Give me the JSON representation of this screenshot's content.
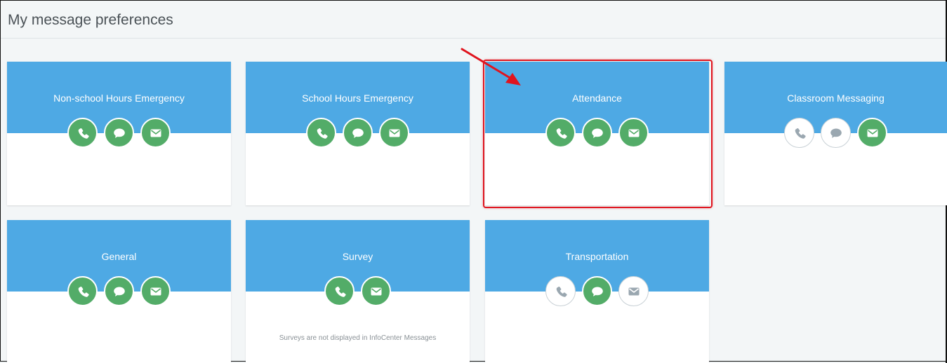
{
  "page": {
    "title": "My message preferences"
  },
  "colors": {
    "band": "#4ea9e4",
    "enabled": "#53ac68",
    "disabled_icon": "#9aa7b0",
    "highlight": "#e0141e"
  },
  "cards": [
    {
      "name": "Non-school Hours Emergency",
      "channels": {
        "phone": true,
        "sms": true,
        "email": true
      }
    },
    {
      "name": "School Hours Emergency",
      "channels": {
        "phone": true,
        "sms": true,
        "email": true
      }
    },
    {
      "name": "Attendance",
      "channels": {
        "phone": true,
        "sms": true,
        "email": true
      },
      "highlighted": true
    },
    {
      "name": "Classroom Messaging",
      "channels": {
        "phone": false,
        "sms": false,
        "email": true
      }
    },
    {
      "name": "General",
      "channels": {
        "phone": true,
        "sms": true,
        "email": true
      }
    },
    {
      "name": "Survey",
      "channels": {
        "phone": true,
        "email": true
      },
      "note": "Surveys are not displayed in InfoCenter Messages"
    },
    {
      "name": "Transportation",
      "channels": {
        "phone": false,
        "sms": true,
        "email": false
      }
    }
  ],
  "icons": {
    "phone": "phone-icon",
    "sms": "chat-bubble-icon",
    "email": "envelope-icon"
  }
}
